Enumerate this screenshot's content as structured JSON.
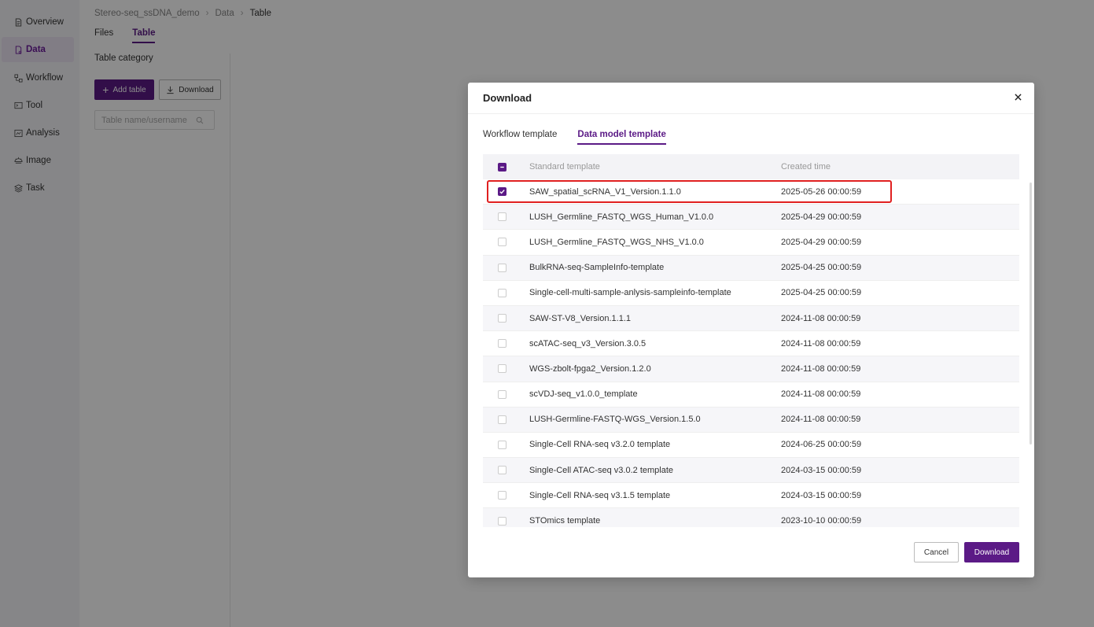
{
  "sidebar": {
    "items": [
      {
        "label": "Overview",
        "icon": "document-icon"
      },
      {
        "label": "Data",
        "icon": "data-file-icon",
        "active": true
      },
      {
        "label": "Workflow",
        "icon": "workflow-icon"
      },
      {
        "label": "Tool",
        "icon": "tool-icon"
      },
      {
        "label": "Analysis",
        "icon": "analysis-icon"
      },
      {
        "label": "Image",
        "icon": "image-icon"
      },
      {
        "label": "Task",
        "icon": "task-layers-icon"
      }
    ]
  },
  "breadcrumb": [
    "Stereo-seq_ssDNA_demo",
    "Data",
    "Table"
  ],
  "page_tabs": [
    {
      "label": "Files",
      "active": false
    },
    {
      "label": "Table",
      "active": true
    }
  ],
  "left_panel": {
    "title": "Table category",
    "add_label": "Add table",
    "download_label": "Download",
    "search_placeholder": "Table name/username"
  },
  "modal": {
    "title": "Download",
    "tabs": [
      {
        "label": "Workflow template",
        "active": false
      },
      {
        "label": "Data model template",
        "active": true
      }
    ],
    "columns": {
      "name": "Standard template",
      "time": "Created time"
    },
    "rows": [
      {
        "name": "SAW_spatial_scRNA_V1_Version.1.1.0",
        "time": "2025-05-26 00:00:59",
        "checked": true
      },
      {
        "name": "LUSH_Germline_FASTQ_WGS_Human_V1.0.0",
        "time": "2025-04-29 00:00:59",
        "checked": false
      },
      {
        "name": "LUSH_Germline_FASTQ_WGS_NHS_V1.0.0",
        "time": "2025-04-29 00:00:59",
        "checked": false
      },
      {
        "name": "BulkRNA-seq-SampleInfo-template",
        "time": "2025-04-25 00:00:59",
        "checked": false
      },
      {
        "name": "Single-cell-multi-sample-anlysis-sampleinfo-template",
        "time": "2025-04-25 00:00:59",
        "checked": false
      },
      {
        "name": "SAW-ST-V8_Version.1.1.1",
        "time": "2024-11-08 00:00:59",
        "checked": false
      },
      {
        "name": "scATAC-seq_v3_Version.3.0.5",
        "time": "2024-11-08 00:00:59",
        "checked": false
      },
      {
        "name": "WGS-zbolt-fpga2_Version.1.2.0",
        "time": "2024-11-08 00:00:59",
        "checked": false
      },
      {
        "name": "scVDJ-seq_v1.0.0_template",
        "time": "2024-11-08 00:00:59",
        "checked": false
      },
      {
        "name": "LUSH-Germline-FASTQ-WGS_Version.1.5.0",
        "time": "2024-11-08 00:00:59",
        "checked": false
      },
      {
        "name": "Single-Cell RNA-seq v3.2.0 template",
        "time": "2024-06-25 00:00:59",
        "checked": false
      },
      {
        "name": "Single-Cell ATAC-seq v3.0.2 template",
        "time": "2024-03-15 00:00:59",
        "checked": false
      },
      {
        "name": "Single-Cell RNA-seq v3.1.5 template",
        "time": "2024-03-15 00:00:59",
        "checked": false
      },
      {
        "name": "STOmics template",
        "time": "2023-10-10 00:00:59",
        "checked": false
      }
    ],
    "cancel_label": "Cancel",
    "download_label": "Download"
  },
  "colors": {
    "accent": "#5b1a86",
    "highlight": "#e02020"
  }
}
